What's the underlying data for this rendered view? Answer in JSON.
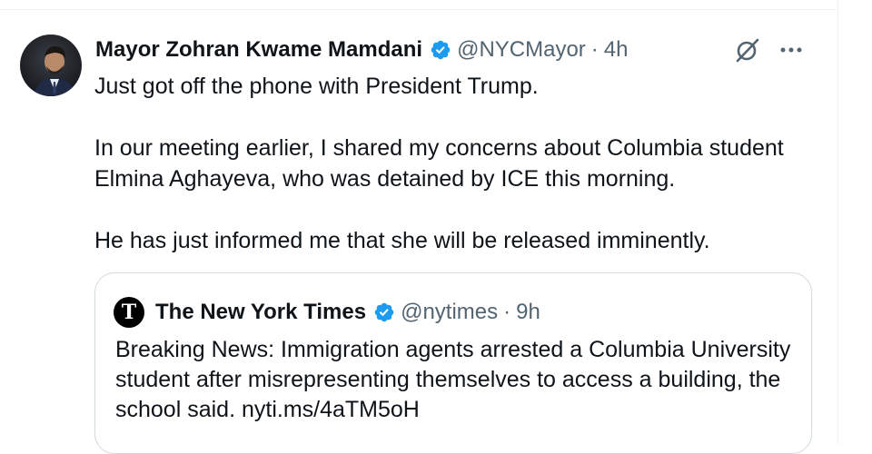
{
  "tweet": {
    "author": {
      "display_name": "Mayor Zohran Kwame Mamdani",
      "handle": "@NYCMayor",
      "separator": "·",
      "time": "4h",
      "avatar_icon": "user-avatar-photo",
      "verified_icon": "verified-badge-icon",
      "verified_color": "#1d9bf0"
    },
    "actions": {
      "grok_icon": "grok-icon",
      "more_icon": "more-dots-icon"
    },
    "text": {
      "p1": "Just got off the phone with President Trump.",
      "p2": "In our meeting earlier, I shared my concerns about Columbia student Elmina Aghayeva, who was detained by ICE this morning.",
      "p3": "He has just informed me that she will be released imminently."
    },
    "quote": {
      "avatar_glyph": "T",
      "display_name": "The New York Times",
      "handle": "@nytimes",
      "separator": "·",
      "time": "9h",
      "text": "Breaking News: Immigration agents arrested a Columbia University student after misrepresenting themselves to access a building, the school said. nyti.ms/4aTM5oH"
    }
  },
  "colors": {
    "text_primary": "#0f1419",
    "text_secondary": "#536471",
    "border": "#cfd9de",
    "verified_blue": "#1d9bf0"
  }
}
